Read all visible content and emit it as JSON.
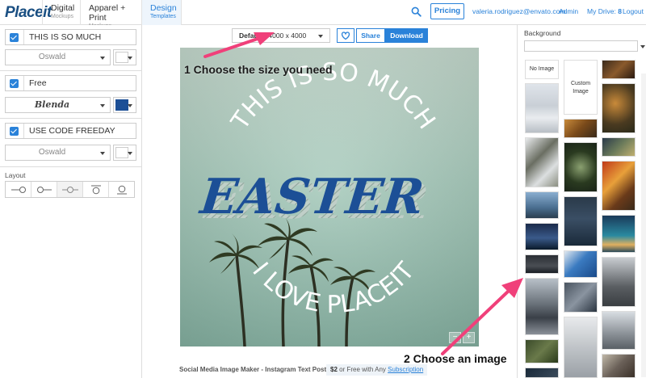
{
  "header": {
    "logo": "Placeit",
    "tabs": [
      {
        "label": "Digital",
        "sub": "Mockups"
      },
      {
        "label": "Apparel + Print",
        "sub": "Mockups"
      },
      {
        "label": "Design",
        "sub": "Templates",
        "active": true
      }
    ],
    "pricing": "Pricing",
    "email": "valeria.rodriguez@envato.com",
    "admin": "Admin",
    "my_drive_label": "My Drive:",
    "my_drive_count": "8",
    "logout": "Logout"
  },
  "left_panel": {
    "text_layers": [
      {
        "text": "THIS IS SO MUCH",
        "font": "Oswald",
        "color": "#ffffff",
        "checked": true
      },
      {
        "text": "Free",
        "font": "Blenda",
        "color": "#1c4f96",
        "checked": true
      },
      {
        "text": "USE CODE FREEDAY",
        "font": "Oswald",
        "color": "#ffffff",
        "checked": true
      }
    ],
    "layout_label": "Layout"
  },
  "toolbar": {
    "size_prefix": "Default - ",
    "size_value": "4000 x 4000",
    "share": "Share",
    "download": "Download"
  },
  "canvas": {
    "top_text": "THIS IS SO MUCH",
    "middle_text": "EASTER",
    "bottom_text": "I LOVE PLACEIT",
    "zoom_minus": "−",
    "zoom_plus": "+"
  },
  "footer": {
    "caption": "Social Media Image Maker - Instagram Text Post",
    "price": "$2",
    "price_suffix": " or Free with Any ",
    "subscription": "Subscription"
  },
  "right_panel": {
    "label": "Background",
    "no_image": "No Image",
    "custom_image": "Custom Image"
  },
  "annotations": {
    "step1": "1 Choose the size you need",
    "step2": "2 Choose an image"
  },
  "colors": {
    "accent": "#2a82d9",
    "arrow": "#f0407a",
    "easter_blue": "#1c4f96"
  }
}
